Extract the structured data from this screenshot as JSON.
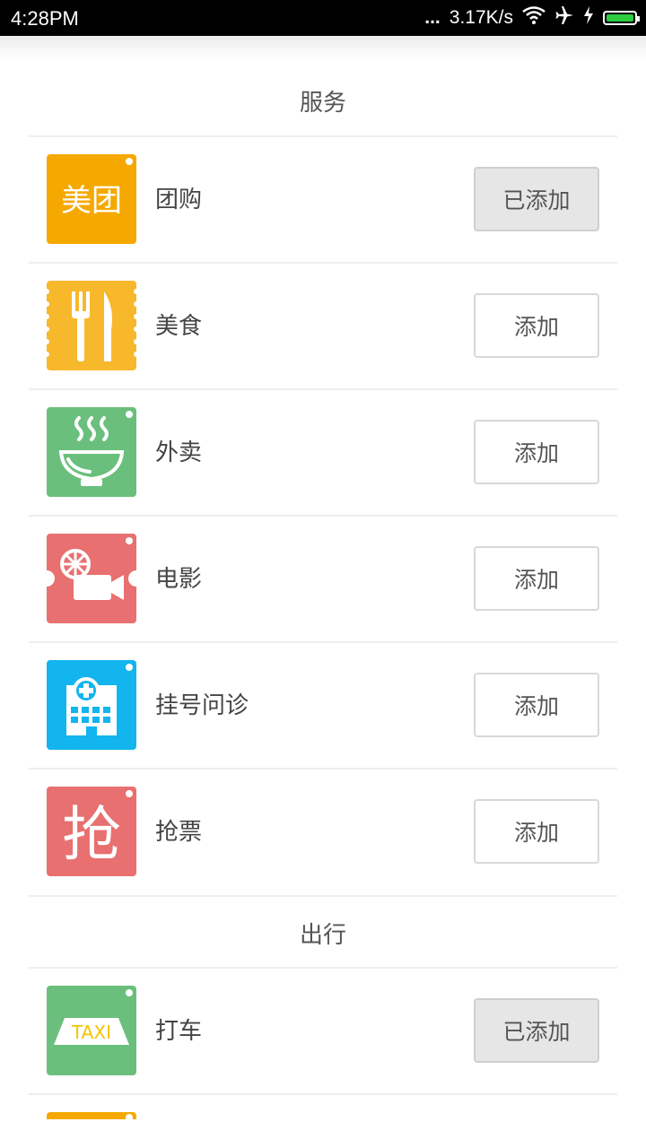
{
  "status_bar": {
    "time": "4:28PM",
    "dots": "...",
    "speed": "3.17K/s",
    "icons": [
      "wifi-icon",
      "airplane-icon",
      "charging-icon",
      "battery-icon"
    ]
  },
  "sections": [
    {
      "title": "服务",
      "items": [
        {
          "icon": "meituan-icon",
          "icon_text": "美团",
          "color": "#F5A900",
          "label": "团购",
          "button": "已添加",
          "added": true
        },
        {
          "icon": "fork-knife-icon",
          "color": "#F7B82B",
          "label": "美食",
          "button": "添加",
          "added": false
        },
        {
          "icon": "bowl-icon",
          "color": "#6ABF7D",
          "label": "外卖",
          "button": "添加",
          "added": false
        },
        {
          "icon": "movie-camera-icon",
          "color": "#E87070",
          "label": "电影",
          "button": "添加",
          "added": false
        },
        {
          "icon": "hospital-icon",
          "color": "#12B5EE",
          "label": "挂号问诊",
          "button": "添加",
          "added": false
        },
        {
          "icon": "grab-ticket-icon",
          "icon_text": "抢",
          "color": "#E87070",
          "label": "抢票",
          "button": "添加",
          "added": false
        }
      ]
    },
    {
      "title": "出行",
      "items": [
        {
          "icon": "taxi-icon",
          "icon_text": "TAXI",
          "color": "#6ABF7D",
          "label": "打车",
          "button": "已添加",
          "added": true
        }
      ]
    }
  ],
  "colors": {
    "accent_added_bg": "#E6E6E6",
    "divider": "#EEEEEE"
  }
}
